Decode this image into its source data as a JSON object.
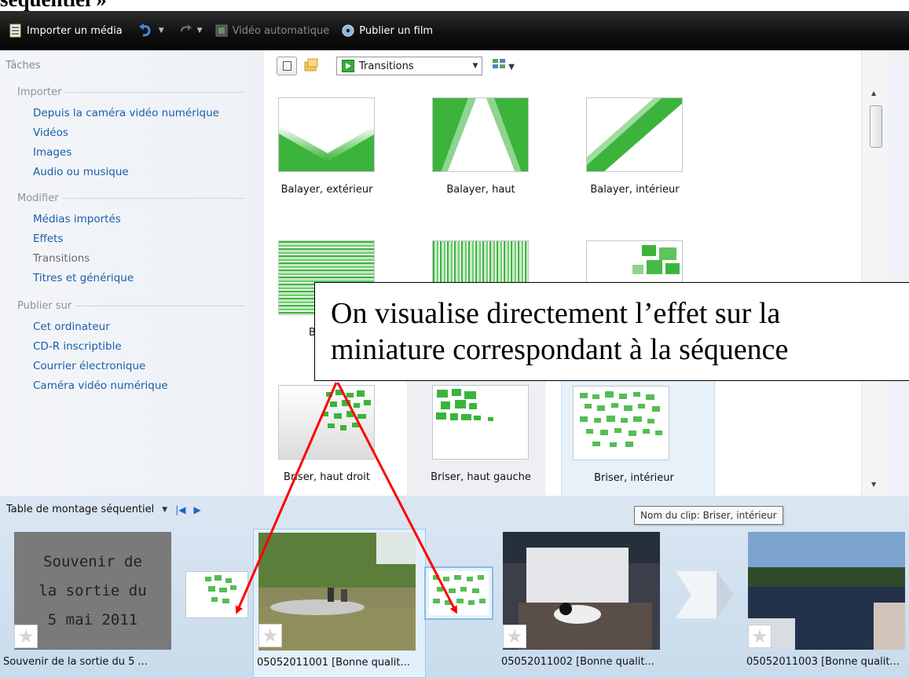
{
  "doc_heading": "séquentiel »",
  "toolbar": {
    "import_label": "Importer un média",
    "auto_movie_label": "Vidéo automatique",
    "publish_label": "Publier un film"
  },
  "tasks": {
    "title": "Tâches",
    "import_group": "Importer",
    "import_items": [
      "Depuis la caméra vidéo numérique",
      "Vidéos",
      "Images",
      "Audio ou musique"
    ],
    "edit_group": "Modifier",
    "edit_items": [
      "Médias importés",
      "Effets",
      "Transitions",
      "Titres et générique"
    ],
    "publish_group": "Publier sur",
    "publish_items": [
      "Cet ordinateur",
      "CD-R inscriptible",
      "Courrier électronique",
      "Caméra vidéo numérique"
    ]
  },
  "content": {
    "dropdown_value": "Transitions",
    "tiles": [
      "Balayer, extérieur",
      "Balayer, haut",
      "Balayer, intérieur",
      "Barres,",
      "",
      "",
      "Briser, haut droit",
      "Briser, haut gauche",
      "Briser, intérieur"
    ]
  },
  "storyboard": {
    "label": "Table de montage séquentiel",
    "tooltip": "Nom du clip: Briser, intérieur",
    "title_card_lines": [
      "Souvenir de",
      "la sortie du",
      "5 mai 2011"
    ],
    "clips": [
      "Souvenir de la sortie du 5 ...",
      "05052011001 [Bonne qualit...",
      "05052011002 [Bonne qualit...",
      "05052011003 [Bonne qualit..."
    ]
  },
  "callout": {
    "line1": "On visualise directement l’effet sur la",
    "line2": "miniature correspondant à la séquence"
  },
  "colors": {
    "toolbar": "#0f0f0f",
    "link": "#1a5ea8",
    "transition_green": "#3cb43c",
    "arrow": "#ff0000"
  }
}
